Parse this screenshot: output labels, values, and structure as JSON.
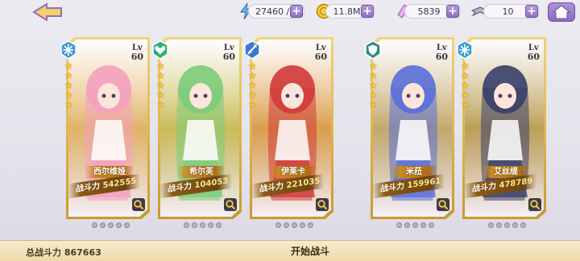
{
  "topbar": {
    "stamina": "27460 / 15",
    "gold": "11.8M",
    "crystals": "5839",
    "tickets": "10"
  },
  "cards": [
    {
      "name": "西尔维娅",
      "power_label": "战斗力",
      "power": "542555",
      "level_label": "Lv",
      "level": "60",
      "role": "snowflake-icon",
      "stars": 5,
      "accent": "#f4a0c0"
    },
    {
      "name": "希尔芙",
      "power_label": "战斗力",
      "power": "104053",
      "level_label": "Lv",
      "level": "60",
      "role": "heart-icon",
      "stars": 5,
      "accent": "#7ccc7a"
    },
    {
      "name": "伊莱卡",
      "power_label": "战斗力",
      "power": "221035",
      "level_label": "Lv",
      "level": "60",
      "role": "sword-icon",
      "stars": 5,
      "accent": "#d23a3a"
    },
    {
      "name": "米菈",
      "power_label": "战斗力",
      "power": "159961",
      "level_label": "Lv",
      "level": "60",
      "role": "shield-icon",
      "stars": 5,
      "accent": "#5a6fd8"
    },
    {
      "name": "艾丝缇",
      "power_label": "战斗力",
      "power": "478789",
      "level_label": "Lv",
      "level": "60",
      "role": "snowflake-icon",
      "stars": 5,
      "accent": "#3a3f6a"
    }
  ],
  "bottombar": {
    "total_power": "总战斗力 867663",
    "start_label": "开始战斗"
  }
}
